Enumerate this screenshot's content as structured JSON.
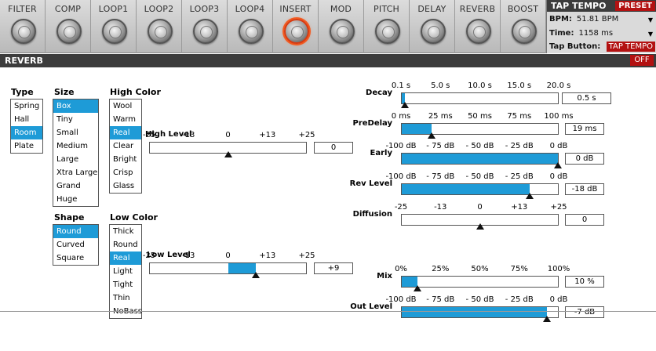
{
  "fx_blocks": [
    {
      "label": "FILTER"
    },
    {
      "label": "COMP"
    },
    {
      "label": "LOOP1"
    },
    {
      "label": "LOOP2"
    },
    {
      "label": "LOOP3"
    },
    {
      "label": "LOOP4"
    },
    {
      "label": "INSERT"
    },
    {
      "label": "MOD"
    },
    {
      "label": "PITCH"
    },
    {
      "label": "DELAY"
    },
    {
      "label": "REVERB"
    },
    {
      "label": "BOOST"
    }
  ],
  "tap": {
    "title": "TAP TEMPO",
    "preset": "PRESET",
    "bpm_label": "BPM:",
    "bpm_value": "51.81 BPM",
    "time_label": "Time:",
    "time_value": "1158 ms",
    "tap_label": "Tap Button:",
    "tap_button": "TAP TEMPO"
  },
  "section": {
    "title": "REVERB",
    "power": "OFF"
  },
  "type": {
    "header": "Type",
    "items": [
      "Spring",
      "Hall",
      "Room",
      "Plate"
    ],
    "selected": 2
  },
  "size": {
    "header": "Size",
    "items": [
      "Box",
      "Tiny",
      "Small",
      "Medium",
      "Large",
      "Xtra Large",
      "Grand",
      "Huge"
    ],
    "selected": 0
  },
  "high_color": {
    "header": "High Color",
    "items": [
      "Wool",
      "Warm",
      "Real",
      "Clear",
      "Bright",
      "Crisp",
      "Glass"
    ],
    "selected": 2
  },
  "shape": {
    "header": "Shape",
    "items": [
      "Round",
      "Curved",
      "Square"
    ],
    "selected": 0
  },
  "low_color": {
    "header": "Low Color",
    "items": [
      "Thick",
      "Round",
      "Real",
      "Light",
      "Tight",
      "Thin",
      "NoBass"
    ],
    "selected": 2
  },
  "params": {
    "high_level": {
      "label": "High Level",
      "ticks": [
        "-25",
        "-13",
        "0",
        "+13",
        "+25"
      ],
      "value": "0",
      "min": -25,
      "max": 25,
      "num": 0,
      "center": true
    },
    "low_level": {
      "label": "Low Level",
      "ticks": [
        "-25",
        "-13",
        "0",
        "+13",
        "+25"
      ],
      "value": "+9",
      "min": -25,
      "max": 25,
      "num": 9,
      "center": true
    },
    "decay": {
      "label": "Decay",
      "ticks": [
        "0.1 s",
        "5.0 s",
        "10.0 s",
        "15.0 s",
        "20.0 s"
      ],
      "value": "0.5 s",
      "min": 0.1,
      "max": 20,
      "num": 0.5,
      "center": false
    },
    "predelay": {
      "label": "PreDelay",
      "ticks": [
        "0 ms",
        "25 ms",
        "50 ms",
        "75 ms",
        "100 ms"
      ],
      "value": "19 ms",
      "min": 0,
      "max": 100,
      "num": 19,
      "center": false
    },
    "early": {
      "label": "Early",
      "ticks": [
        "-100 dB",
        "- 75 dB",
        "- 50 dB",
        "- 25 dB",
        "0 dB"
      ],
      "value": "0 dB",
      "min": -100,
      "max": 0,
      "num": 0,
      "center": false
    },
    "rev_level": {
      "label": "Rev Level",
      "ticks": [
        "-100 dB",
        "- 75 dB",
        "- 50 dB",
        "- 25 dB",
        "0 dB"
      ],
      "value": "-18 dB",
      "min": -100,
      "max": 0,
      "num": -18,
      "center": false
    },
    "diffusion": {
      "label": "Diffusion",
      "ticks": [
        "-25",
        "-13",
        "0",
        "+13",
        "+25"
      ],
      "value": "0",
      "min": -25,
      "max": 25,
      "num": 0,
      "center": true
    },
    "mix": {
      "label": "Mix",
      "ticks": [
        "0%",
        "25%",
        "50%",
        "75%",
        "100%"
      ],
      "value": "10 %",
      "min": 0,
      "max": 100,
      "num": 10,
      "center": false
    },
    "out_level": {
      "label": "Out Level",
      "ticks": [
        "-100 dB",
        "- 75 dB",
        "- 50 dB",
        "- 25 dB",
        "0 dB"
      ],
      "value": "-7 dB",
      "min": -100,
      "max": 0,
      "num": -7,
      "center": false
    }
  },
  "colors": {
    "accent": "#1e9bd7",
    "active_knob": "#f25a20",
    "power_red": "#b31111"
  }
}
